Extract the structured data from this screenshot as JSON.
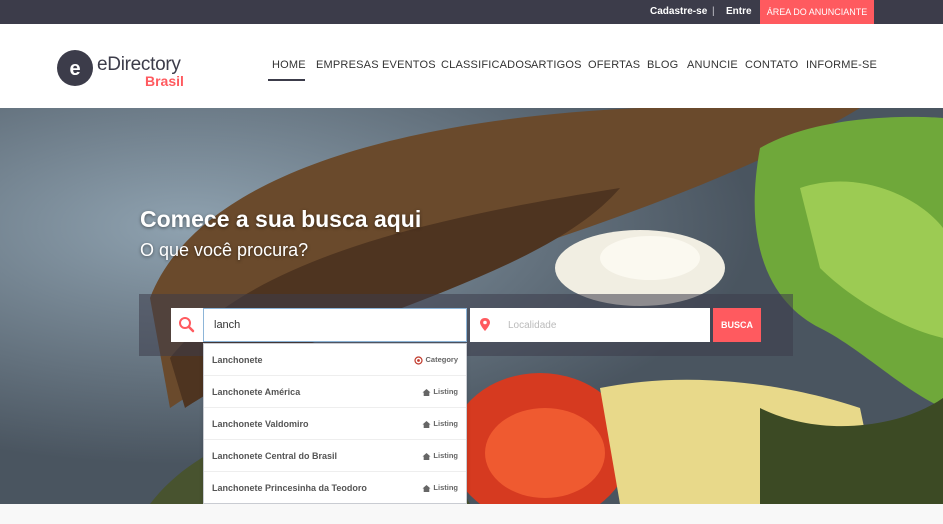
{
  "topbar": {
    "register_label": "Cadastre-se",
    "separator": "|",
    "login_label": "Entre",
    "advertiser_area_label": "ÁREA DO ANUNCIANTE"
  },
  "logo": {
    "letter": "e",
    "name": "eDirectory",
    "sub": "Brasil"
  },
  "nav": {
    "items": [
      "HOME",
      "EMPRESAS",
      "EVENTOS",
      "CLASSIFICADOS",
      "ARTIGOS",
      "OFERTAS",
      "BLOG",
      "ANUNCIE",
      "CONTATO",
      "INFORME-SE"
    ],
    "active": "HOME"
  },
  "hero": {
    "title": "Comece a sua busca aqui",
    "subtitle": "O que você procura?"
  },
  "search": {
    "keyword_value": "lanch",
    "location_placeholder": "Localidade",
    "button_label": "BUSCA"
  },
  "autocomplete": {
    "items": [
      {
        "name": "Lanchonete",
        "type": "Category",
        "icon": "category-icon"
      },
      {
        "name": "Lanchonete América",
        "type": "Listing",
        "icon": "home-icon"
      },
      {
        "name": "Lanchonete Valdomiro",
        "type": "Listing",
        "icon": "home-icon"
      },
      {
        "name": "Lanchonete Central do Brasil",
        "type": "Listing",
        "icon": "home-icon"
      },
      {
        "name": "Lanchonete Princesinha da Teodoro",
        "type": "Listing",
        "icon": "home-icon"
      }
    ]
  },
  "colors": {
    "accent": "#ff5a5f",
    "dark": "#3c3c4a"
  }
}
